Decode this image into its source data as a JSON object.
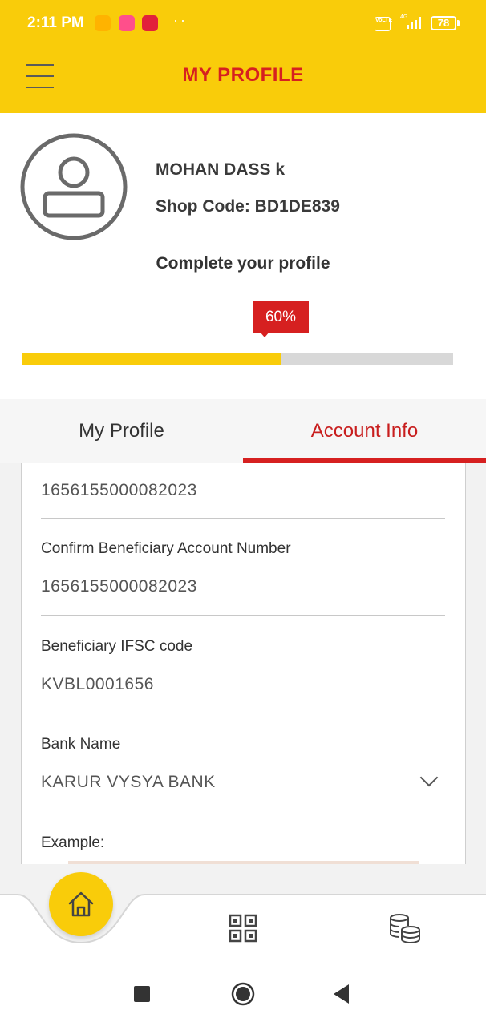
{
  "status_bar": {
    "time": "2:11 PM",
    "volte": "VoLTE",
    "network": "4G",
    "battery": "78"
  },
  "header": {
    "title": "MY PROFILE",
    "menu_icon": "hamburger-menu-icon"
  },
  "profile": {
    "name": "MOHAN DASS k",
    "shop_code": "Shop Code: BD1DE839",
    "complete_prompt": "Complete your profile",
    "progress_label": "60%",
    "progress": 0.6
  },
  "tabs": {
    "my_profile": "My Profile",
    "account_info": "Account Info",
    "active": "account_info"
  },
  "form": {
    "account_number_value": "1656155000082023",
    "confirm_account_label": "Confirm Beneficiary Account Number",
    "confirm_account_value": "1656155000082023",
    "ifsc_label": "Beneficiary IFSC code",
    "ifsc_value": "KVBL0001656",
    "bank_label": "Bank Name",
    "bank_value": "KARUR VYSYA BANK",
    "example_label": "Example:"
  },
  "bottom_nav": {
    "items": [
      "home-icon",
      "qr-code-icon",
      "coins-icon"
    ]
  },
  "colors": {
    "brand_yellow": "#f9cc0a",
    "brand_red": "#d62020"
  }
}
